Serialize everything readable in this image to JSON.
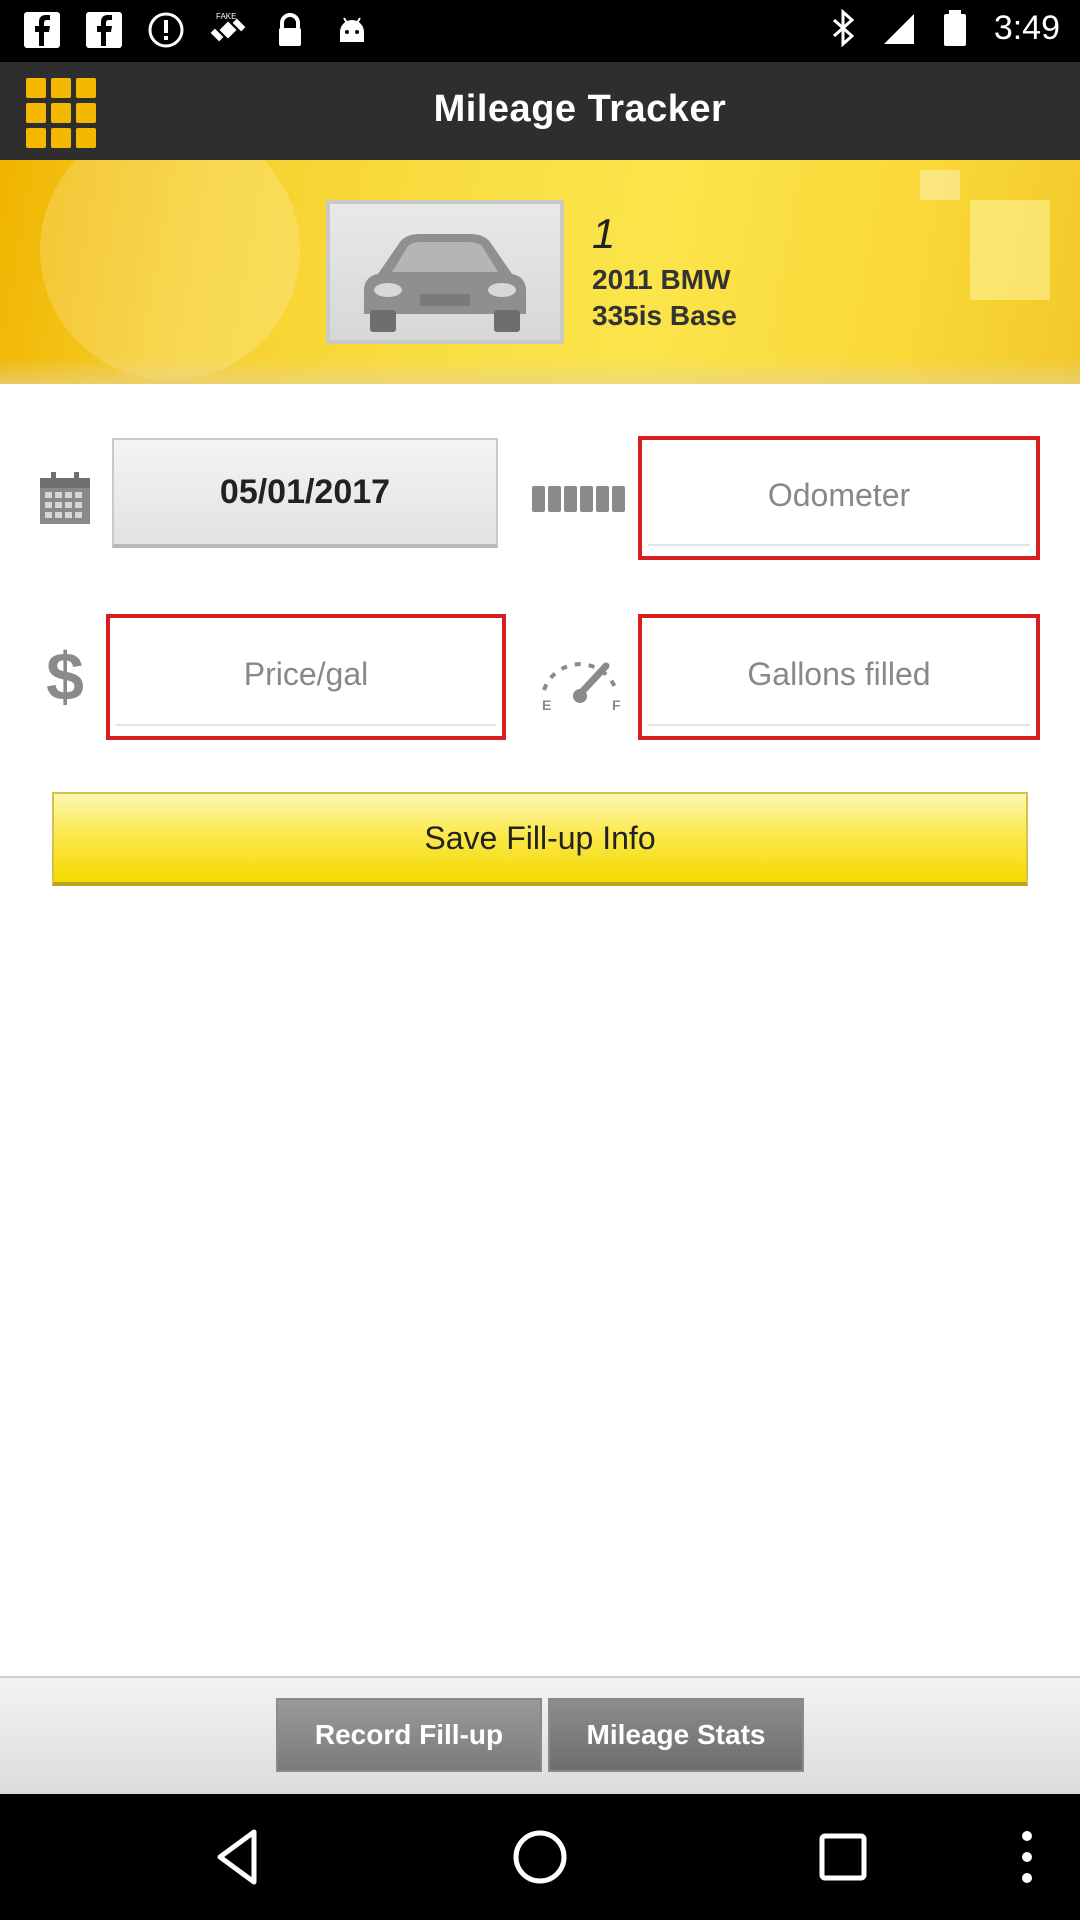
{
  "status_bar": {
    "time": "3:49",
    "left_icons": [
      "facebook-icon",
      "facebook-icon",
      "alert-icon",
      "fake-gps-satellite-icon",
      "lock-icon",
      "android-icon"
    ],
    "right_icons": [
      "bluetooth-icon",
      "signal-icon",
      "battery-icon"
    ]
  },
  "header": {
    "title": "Mileage Tracker",
    "menu_icon": "grid-menu-icon"
  },
  "vehicle": {
    "number": "1",
    "line1": "2011 BMW",
    "line2": "335is Base",
    "image_icon": "car-icon"
  },
  "form": {
    "date_value": "05/01/2017",
    "date_icon": "calendar-icon",
    "odometer_icon": "odometer-icon",
    "odometer_placeholder": "Odometer",
    "price_icon": "dollar-icon",
    "price_placeholder": "Price/gal",
    "fuel_icon": "fuel-gauge-icon",
    "gallons_placeholder": "Gallons filled",
    "save_label": "Save Fill-up Info"
  },
  "tabs": {
    "record_label": "Record Fill-up",
    "stats_label": "Mileage Stats",
    "active": "Record Fill-up"
  },
  "navbar": {
    "icons": [
      "back-icon",
      "home-icon",
      "recents-icon",
      "more-options-icon"
    ]
  },
  "colors": {
    "header_bg": "#2e2e2e",
    "banner_yellow": "#f9dd41",
    "field_border_red": "#d81e1e",
    "save_button_yellow": "#fbe94e"
  }
}
